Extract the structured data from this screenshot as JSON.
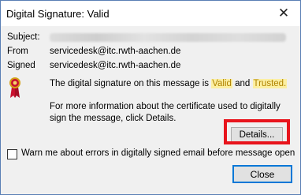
{
  "window": {
    "title": "Digital Signature: Valid",
    "close_glyph": "✕"
  },
  "fields": {
    "subject_label": "Subject:",
    "from_label": "From",
    "from_value": "servicedesk@itc.rwth-aachen.de",
    "signed_label": "Signed",
    "signed_value": "servicedesk@itc.rwth-aachen.de"
  },
  "message": {
    "line1_prefix": "The digital signature on this message is ",
    "valid_word": "Valid",
    "and_word": " and ",
    "trusted_word": "Trusted.",
    "line2": "For more information about the certificate used to digitally",
    "line3": "sign the message, click Details."
  },
  "buttons": {
    "details_label": "Details...",
    "close_label": "Close"
  },
  "checkbox": {
    "label": "Warn me about errors in digitally signed email before message open",
    "checked": false
  },
  "colors": {
    "highlight_box": "#e8141c",
    "status_highlight_bg": "#fcefa1",
    "focus_border": "#0078d7"
  },
  "icons": {
    "ribbon": "award-ribbon-icon",
    "close": "close-icon"
  }
}
